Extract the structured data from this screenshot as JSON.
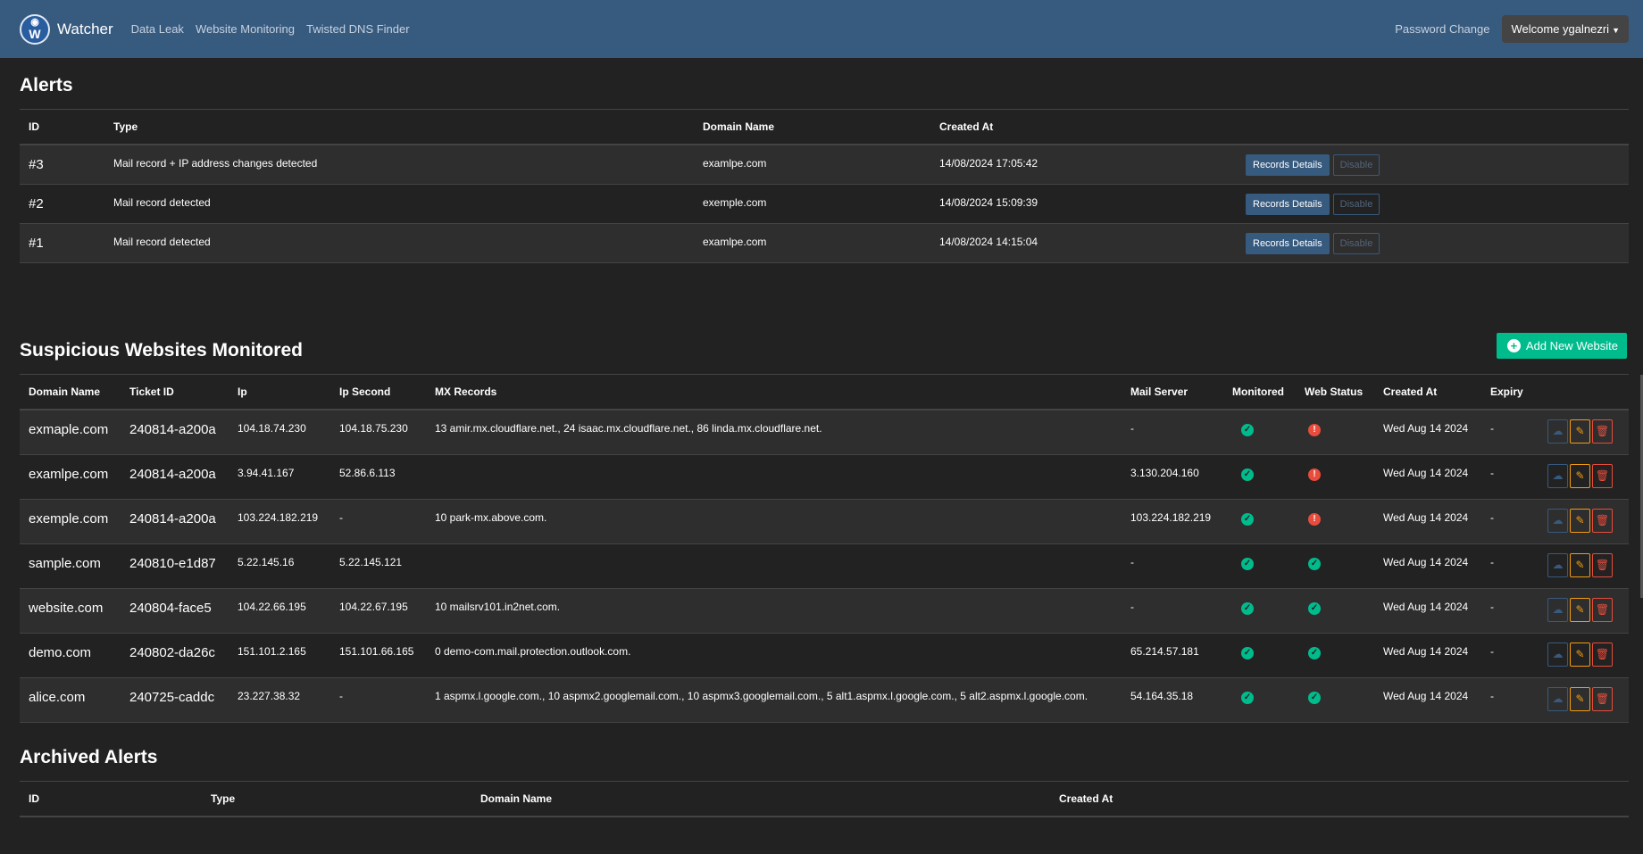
{
  "nav": {
    "brand": "Watcher",
    "links": [
      "Data Leak",
      "Website Monitoring",
      "Twisted DNS Finder"
    ],
    "password_change": "Password Change",
    "welcome": "Welcome ygalnezri"
  },
  "alerts": {
    "title": "Alerts",
    "headers": [
      "ID",
      "Type",
      "Domain Name",
      "Created At"
    ],
    "records_label": "Records Details",
    "disable_label": "Disable",
    "rows": [
      {
        "id": "#3",
        "type": "Mail record + IP address changes detected",
        "domain": "examlpe.com",
        "created": "14/08/2024 17:05:42"
      },
      {
        "id": "#2",
        "type": "Mail record detected",
        "domain": "exemple.com",
        "created": "14/08/2024 15:09:39"
      },
      {
        "id": "#1",
        "type": "Mail record detected",
        "domain": "examlpe.com",
        "created": "14/08/2024 14:15:04"
      }
    ]
  },
  "monitored": {
    "title": "Suspicious Websites Monitored",
    "add_label": "Add New Website",
    "headers": [
      "Domain Name",
      "Ticket ID",
      "Ip",
      "Ip Second",
      "MX Records",
      "Mail Server",
      "Monitored",
      "Web Status",
      "Created At",
      "Expiry"
    ],
    "rows": [
      {
        "domain": "exmaple.com",
        "ticket": "240814-a200a",
        "ip": "104.18.74.230",
        "ip2": "104.18.75.230",
        "mx": "13 amir.mx.cloudflare.net., 24 isaac.mx.cloudflare.net., 86 linda.mx.cloudflare.net.",
        "mail": "-",
        "web_ok": false,
        "created": "Wed Aug 14 2024",
        "expiry": "-"
      },
      {
        "domain": "examlpe.com",
        "ticket": "240814-a200a",
        "ip": "3.94.41.167",
        "ip2": "52.86.6.113",
        "mx": "",
        "mail": "3.130.204.160",
        "web_ok": false,
        "created": "Wed Aug 14 2024",
        "expiry": "-"
      },
      {
        "domain": "exemple.com",
        "ticket": "240814-a200a",
        "ip": "103.224.182.219",
        "ip2": "-",
        "mx": "10 park-mx.above.com.",
        "mail": "103.224.182.219",
        "web_ok": false,
        "created": "Wed Aug 14 2024",
        "expiry": "-"
      },
      {
        "domain": "sample.com",
        "ticket": "240810-e1d87",
        "ip": "5.22.145.16",
        "ip2": "5.22.145.121",
        "mx": "",
        "mail": "-",
        "web_ok": true,
        "created": "Wed Aug 14 2024",
        "expiry": "-"
      },
      {
        "domain": "website.com",
        "ticket": "240804-face5",
        "ip": "104.22.66.195",
        "ip2": "104.22.67.195",
        "mx": "10 mailsrv101.in2net.com.",
        "mail": "-",
        "web_ok": true,
        "created": "Wed Aug 14 2024",
        "expiry": "-"
      },
      {
        "domain": "demo.com",
        "ticket": "240802-da26c",
        "ip": "151.101.2.165",
        "ip2": "151.101.66.165",
        "mx": "0 demo-com.mail.protection.outlook.com.",
        "mail": "65.214.57.181",
        "web_ok": true,
        "created": "Wed Aug 14 2024",
        "expiry": "-"
      },
      {
        "domain": "alice.com",
        "ticket": "240725-caddc",
        "ip": "23.227.38.32",
        "ip2": "-",
        "mx": "1 aspmx.l.google.com., 10 aspmx2.googlemail.com., 10 aspmx3.googlemail.com., 5 alt1.aspmx.l.google.com., 5 alt2.aspmx.l.google.com.",
        "mail": "54.164.35.18",
        "web_ok": true,
        "created": "Wed Aug 14 2024",
        "expiry": "-"
      }
    ]
  },
  "archived": {
    "title": "Archived Alerts",
    "headers": [
      "ID",
      "Type",
      "Domain Name",
      "Created At"
    ]
  },
  "colors": {
    "navbar": "#375a7f",
    "background": "#222222",
    "success": "#00bc8c",
    "danger": "#e74c3c",
    "warning": "#f39c12"
  }
}
